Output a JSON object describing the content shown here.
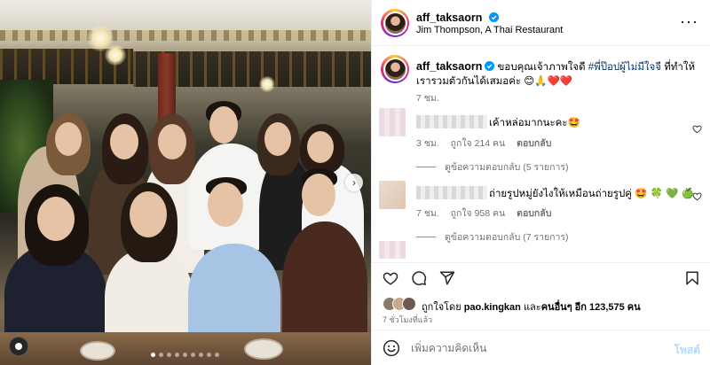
{
  "post_author": {
    "username": "aff_taksaorn",
    "location": "Jim Thompson, A Thai Restaurant",
    "verified": true
  },
  "caption": {
    "username": "aff_taksaorn",
    "text_before": "ขอบคุณเจ้าภาพใจดี ",
    "hashtag": "#พี่ป๊อปผู้ไม่มีใจจี",
    "text_after": " ที่ทำให้เรารวมตัวกันได้เสมอค่ะ 😊🙏❤️❤️",
    "time": "7 ชม."
  },
  "comments": [
    {
      "text": "เค้าหล่อมากนะคะ🤩",
      "time": "3 ชม.",
      "likes": "ถูกใจ 214 คน",
      "reply_label": "ตอบกลับ",
      "view_replies": "ดูข้อความตอบกลับ (5 รายการ)"
    },
    {
      "text": "ถ่ายรูปหมู่ยังไงให้เหมือนถ่ายรูปคู่ 🤩 🍀 💚 🍏",
      "time": "7 ชม.",
      "likes": "ถูกใจ 958 คน",
      "reply_label": "ตอบกลับ",
      "view_replies": "ดูข้อความตอบกลับ (7 รายการ)"
    }
  ],
  "likes_summary": {
    "prefix": "ถูกใจโดย ",
    "user": "pao.kingkan",
    "middle": " และ",
    "others": "คนอื่นๆ อีก 123,575 คน"
  },
  "post_time": "7 ชั่วโมงที่แล้ว",
  "add_comment": {
    "placeholder": "เพิ่มความคิดเห็น",
    "post_label": "โพสต์"
  },
  "icons": {
    "more": "more-options-icon",
    "heart": "heart-icon",
    "comment": "comment-icon",
    "share": "share-icon",
    "bookmark": "bookmark-icon",
    "emoji": "emoji-icon",
    "verified": "verified-badge-icon",
    "next": "chevron-right-icon"
  },
  "colors": {
    "verified": "#0095f6",
    "hashtag": "#00376b",
    "muted": "#737373",
    "post_disabled": "#b3dbff"
  }
}
